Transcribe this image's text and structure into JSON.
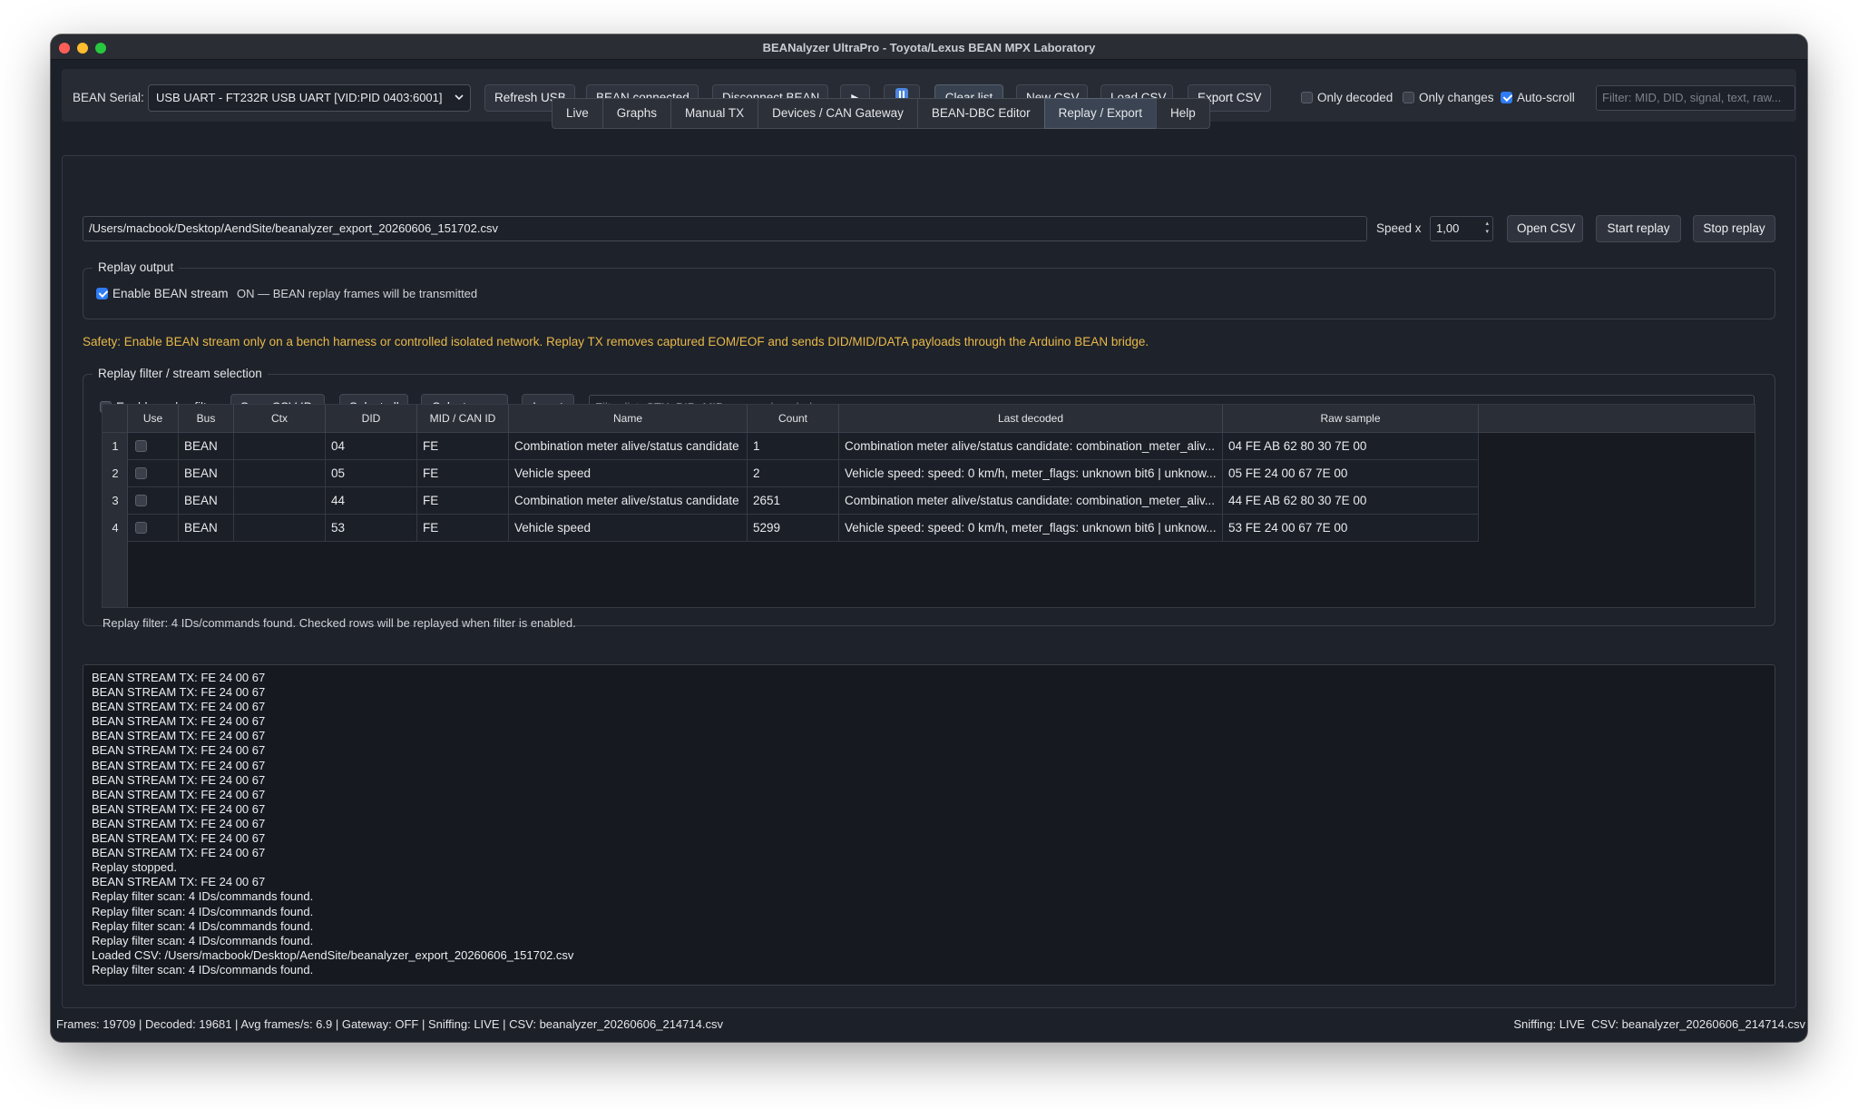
{
  "window": {
    "title": "BEANalyzer UltraPro - Toyota/Lexus BEAN MPX Laboratory"
  },
  "toolbar": {
    "serial_label": "BEAN Serial:",
    "serial_port": "USB UART - FT232R USB UART [VID:PID 0403:6001]",
    "refresh_usb": "Refresh USB",
    "bean_connected": "BEAN connected",
    "disconnect_bean": "Disconnect BEAN",
    "play_icon": "▶",
    "pause_icon": "pause-icon",
    "clear_list": "Clear list",
    "new_csv": "New CSV",
    "load_csv": "Load CSV",
    "export_csv": "Export CSV",
    "only_decoded": "Only decoded",
    "only_decoded_checked": false,
    "only_changes": "Only changes",
    "only_changes_checked": false,
    "auto_scroll": "Auto-scroll",
    "auto_scroll_checked": true,
    "filter_placeholder": "Filter: MID, DID, signal, text, raw..."
  },
  "tabs": [
    {
      "label": "Live",
      "selected": false
    },
    {
      "label": "Graphs",
      "selected": false
    },
    {
      "label": "Manual TX",
      "selected": false
    },
    {
      "label": "Devices / CAN Gateway",
      "selected": false
    },
    {
      "label": "BEAN-DBC Editor",
      "selected": false
    },
    {
      "label": "Replay / Export",
      "selected": true
    },
    {
      "label": "Help",
      "selected": false
    }
  ],
  "replay": {
    "file_path": "/Users/macbook/Desktop/AendSite/beanalyzer_export_20260606_151702.csv",
    "speed_label": "Speed x",
    "speed_value": "1,00",
    "open_csv": "Open CSV",
    "start_replay": "Start replay",
    "stop_replay": "Stop replay",
    "output_group_title": "Replay output",
    "enable_stream_label": "Enable BEAN stream",
    "enable_stream_checked": true,
    "stream_status": "ON — BEAN replay frames will be transmitted",
    "safety_text": "Safety: Enable BEAN stream only on a bench harness or controlled isolated network. Replay TX removes captured EOM/EOF and sends DID/MID/DATA payloads through the Arduino BEAN bridge."
  },
  "filter": {
    "group_title": "Replay filter / stream selection",
    "enable_label": "Enable replay filter",
    "enable_checked": false,
    "scan_csv_ids": "Scan CSV IDs",
    "select_all": "Select all",
    "select_none": "Select none",
    "invert": "Invert",
    "list_placeholder": "Filter list: CTX, DID, MID, name, decoded, raw...",
    "status_text": "Replay filter: 4 IDs/commands found. Checked rows will be replayed when filter is enabled."
  },
  "table": {
    "columns": [
      "Use",
      "Bus",
      "Ctx",
      "DID",
      "MID / CAN ID",
      "Name",
      "Count",
      "Last decoded",
      "Raw sample"
    ],
    "rows": [
      {
        "n": "1",
        "bus": "BEAN",
        "ctx": "",
        "did": "04",
        "mid": "FE",
        "name": "Combination meter alive/status candidate",
        "count": "1",
        "decoded": "Combination meter alive/status candidate: combination_meter_aliv...",
        "raw": "04 FE AB 62 80 30 7E 00"
      },
      {
        "n": "2",
        "bus": "BEAN",
        "ctx": "",
        "did": "05",
        "mid": "FE",
        "name": "Vehicle speed",
        "count": "2",
        "decoded": "Vehicle speed: speed: 0 km/h, meter_flags: unknown bit6 | unknow...",
        "raw": "05 FE 24 00 67 7E 00"
      },
      {
        "n": "3",
        "bus": "BEAN",
        "ctx": "",
        "did": "44",
        "mid": "FE",
        "name": "Combination meter alive/status candidate",
        "count": "2651",
        "decoded": "Combination meter alive/status candidate: combination_meter_aliv...",
        "raw": "44 FE AB 62 80 30 7E 00"
      },
      {
        "n": "4",
        "bus": "BEAN",
        "ctx": "",
        "did": "53",
        "mid": "FE",
        "name": "Vehicle speed",
        "count": "5299",
        "decoded": "Vehicle speed: speed: 0 km/h, meter_flags: unknown bit6 | unknow...",
        "raw": "53 FE 24 00 67 7E 00"
      }
    ]
  },
  "log": [
    "BEAN STREAM TX: FE 24 00 67",
    "BEAN STREAM TX: FE 24 00 67",
    "BEAN STREAM TX: FE 24 00 67",
    "BEAN STREAM TX: FE 24 00 67",
    "BEAN STREAM TX: FE 24 00 67",
    "BEAN STREAM TX: FE 24 00 67",
    "BEAN STREAM TX: FE 24 00 67",
    "BEAN STREAM TX: FE 24 00 67",
    "BEAN STREAM TX: FE 24 00 67",
    "BEAN STREAM TX: FE 24 00 67",
    "BEAN STREAM TX: FE 24 00 67",
    "BEAN STREAM TX: FE 24 00 67",
    "BEAN STREAM TX: FE 24 00 67",
    "Replay stopped.",
    "BEAN STREAM TX: FE 24 00 67",
    "Replay filter scan: 4 IDs/commands found.",
    "Replay filter scan: 4 IDs/commands found.",
    "Replay filter scan: 4 IDs/commands found.",
    "Replay filter scan: 4 IDs/commands found.",
    "Loaded CSV: /Users/macbook/Desktop/AendSite/beanalyzer_export_20260606_151702.csv",
    "Replay filter scan: 4 IDs/commands found."
  ],
  "statusbar": {
    "left": "Frames: 19709 | Decoded: 19681 | Avg frames/s: 6.9 | Gateway: OFF | Sniffing: LIVE | CSV: beanalyzer_20260606_214714.csv",
    "right": "Sniffing: LIVE  CSV: beanalyzer_20260606_214714.csv"
  },
  "colors": {
    "accent": "#2f7cf6",
    "warning": "#e9b949",
    "background": "#1c2028"
  }
}
